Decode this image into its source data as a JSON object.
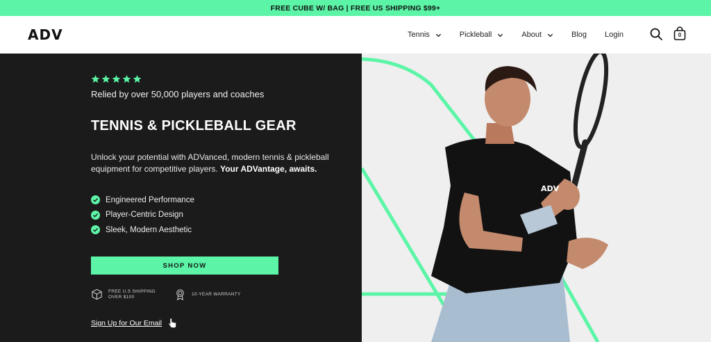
{
  "announcement": "FREE CUBE W/ BAG | FREE US SHIPPING $99+",
  "header": {
    "logo": "ADV",
    "nav": [
      {
        "label": "Tennis",
        "has_dropdown": true
      },
      {
        "label": "Pickleball",
        "has_dropdown": true
      },
      {
        "label": "About",
        "has_dropdown": true
      },
      {
        "label": "Blog",
        "has_dropdown": false
      },
      {
        "label": "Login",
        "has_dropdown": false
      }
    ],
    "search_icon": "search-icon",
    "cart_icon": "shopping-bag-icon",
    "cart_count": "0"
  },
  "hero": {
    "rating_stars": 5,
    "star_color": "#5cf5a7",
    "social_proof": "Relied by over 50,000 players and coaches",
    "headline": "TENNIS & PICKLEBALL GEAR",
    "description": "Unlock your potential with ADVanced, modern tennis & pickleball equipment for competitive players.",
    "description_bold": "Your ADVantage, awaits.",
    "features": [
      "Engineered Performance",
      "Player-Centric Design",
      "Sleek, Modern Aesthetic"
    ],
    "cta_label": "SHOP NOW",
    "perks": [
      {
        "icon": "box-icon",
        "label": "FREE U.S SHIPPING OVER $100"
      },
      {
        "icon": "award-badge-icon",
        "label": "10-YEAR WARRANTY"
      }
    ],
    "signup_link": "Sign Up for Our Email",
    "signup_icon": "pointer-hand-icon"
  },
  "image": {
    "shirt_logo": "ADV",
    "accent_color": "#5cf5a7",
    "panel_color": "#1b1b1b"
  }
}
